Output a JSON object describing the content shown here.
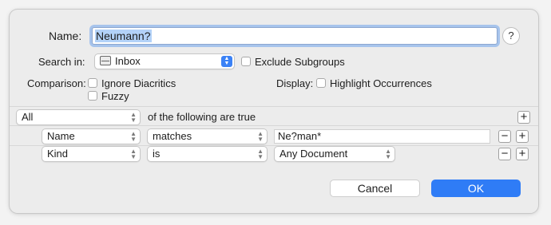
{
  "name": {
    "label": "Name:",
    "value": "Neumann?",
    "help": "?"
  },
  "search_in": {
    "label": "Search in:",
    "value": "Inbox",
    "exclude_label": "Exclude Subgroups"
  },
  "comparison": {
    "label": "Comparison:",
    "ignore_diacritics": "Ignore Diacritics",
    "fuzzy": "Fuzzy"
  },
  "display": {
    "label": "Display:",
    "highlight": "Highlight Occurrences"
  },
  "criteria": {
    "quantifier": "All",
    "suffix": "of the following are true",
    "rows": [
      {
        "field": "Name",
        "operator": "matches",
        "value": "Ne?man*"
      },
      {
        "field": "Kind",
        "operator": "is",
        "value": "Any Document"
      }
    ]
  },
  "buttons": {
    "cancel": "Cancel",
    "ok": "OK",
    "plus": "+",
    "minus": "−"
  },
  "colors": {
    "accent": "#2f7cf6",
    "selection": "#b3d2f8"
  }
}
